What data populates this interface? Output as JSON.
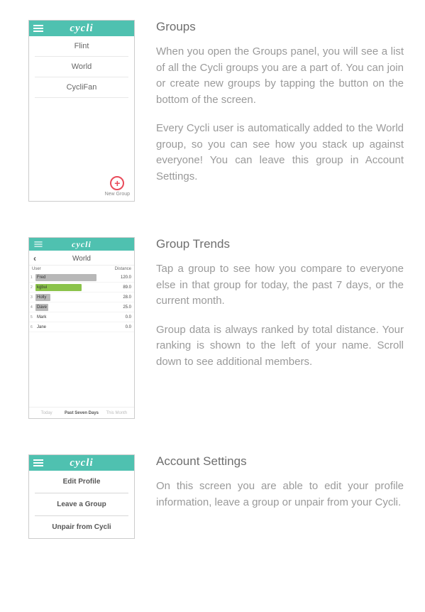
{
  "brand": "cycli",
  "sections": {
    "groups": {
      "heading": "Groups",
      "para1": "When you open the Groups panel, you will see a list of all the Cycli groups you are a part of. You can join or create new groups by tapping the button on the bottom of the screen.",
      "para2": "Every Cycli user is automatically added to the World group, so you can see how you stack up against everyone! You can leave this group in Account Settings.",
      "screenshot": {
        "items": [
          "Flint",
          "World",
          "CycliFan"
        ],
        "new_group_label": "New Group"
      }
    },
    "trends": {
      "heading": "Group Trends",
      "para1": "Tap a group to see how you compare to everyone else in that group for today, the past 7 days, or the current month.",
      "para2": "Group data is always ranked by total distance. Your ranking is shown to the left of your name. Scroll down to see additional members.",
      "screenshot": {
        "title": "World",
        "col_user": "User",
        "col_distance": "Distance",
        "rows": [
          {
            "rank": "1",
            "name": "Fred",
            "dist": "120.0",
            "barpct": 82,
            "color": "grey"
          },
          {
            "rank": "2",
            "name": "kgbui",
            "dist": "89.0",
            "barpct": 62,
            "color": "green"
          },
          {
            "rank": "3",
            "name": "Holly",
            "dist": "28.0",
            "barpct": 20,
            "color": "grey"
          },
          {
            "rank": "4",
            "name": "Dave",
            "dist": "25.0",
            "barpct": 17,
            "color": "grey"
          },
          {
            "rank": "5",
            "name": "Mark",
            "dist": "0.0",
            "barpct": 0,
            "color": "grey"
          },
          {
            "rank": "6",
            "name": "Jane",
            "dist": "0.0",
            "barpct": 0,
            "color": "grey"
          }
        ],
        "tabs": [
          "Today",
          "Past Seven Days",
          "This Month"
        ],
        "active_tab": 1
      }
    },
    "settings": {
      "heading": "Account Settings",
      "para1": "On this screen you are able to edit your profile information, leave a group or unpair from your Cycli.",
      "screenshot": {
        "items": [
          "Edit Profile",
          "Leave a Group",
          "Unpair from Cycli"
        ]
      }
    }
  }
}
